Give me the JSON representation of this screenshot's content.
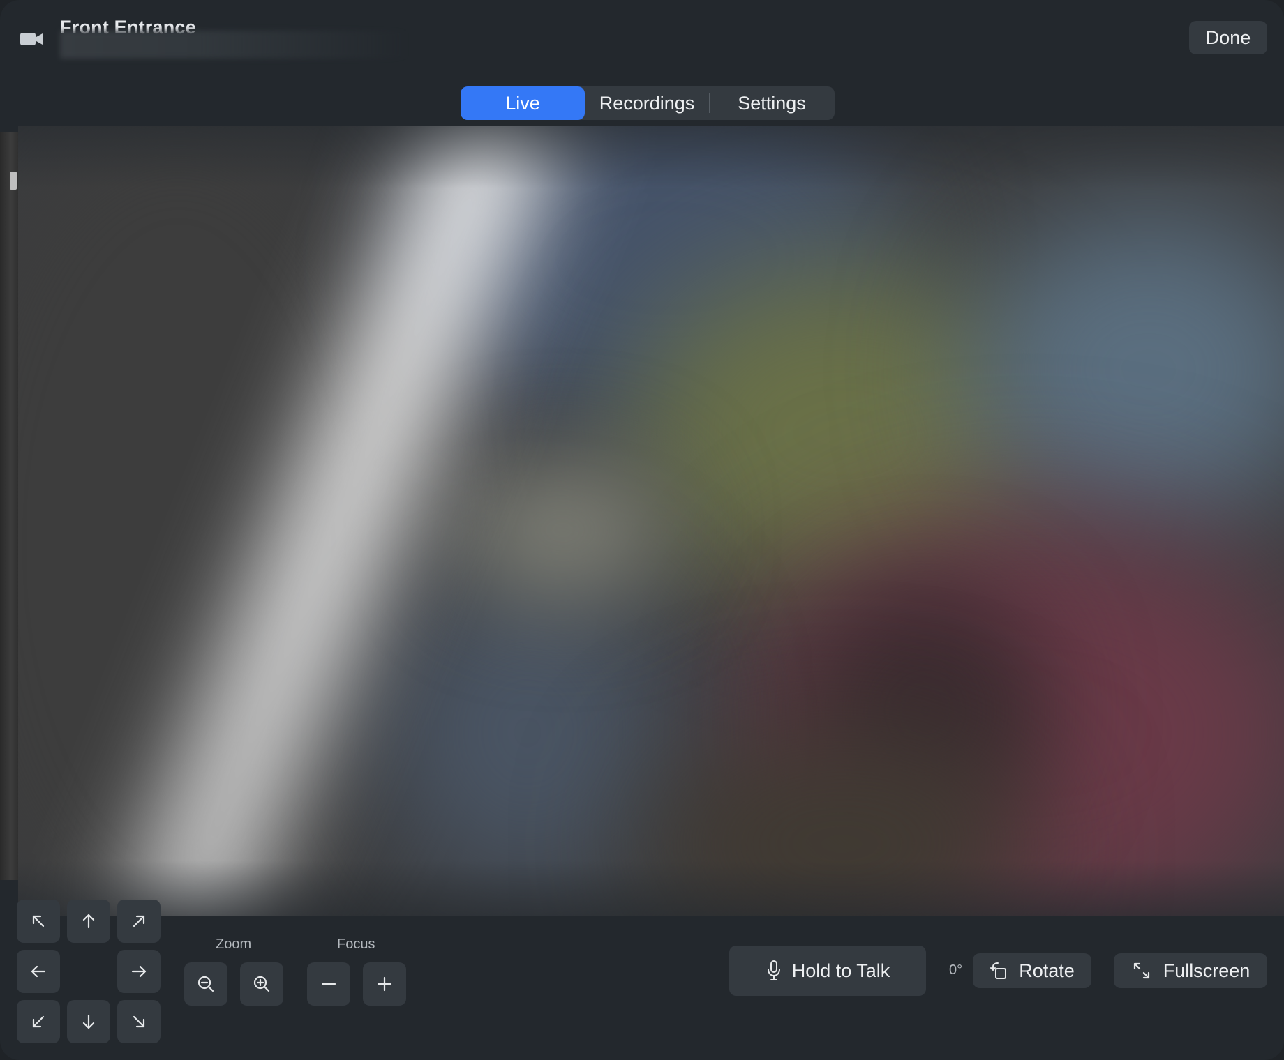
{
  "window": {
    "title": "Front Entrance",
    "done_label": "Done"
  },
  "tabs": [
    {
      "label": "Live",
      "active": true
    },
    {
      "label": "Recordings",
      "active": false
    },
    {
      "label": "Settings",
      "active": false
    }
  ],
  "controls": {
    "zoom_label": "Zoom",
    "focus_label": "Focus",
    "talk_label": "Hold to Talk",
    "rotation_value": "0°",
    "rotate_label": "Rotate",
    "fullscreen_label": "Fullscreen"
  },
  "icons": {
    "camera": "video-camera-icon",
    "pan": [
      "arrow-up-left-icon",
      "arrow-up-icon",
      "arrow-up-right-icon",
      "arrow-left-icon",
      "arrow-right-icon",
      "arrow-down-left-icon",
      "arrow-down-icon",
      "arrow-down-right-icon"
    ],
    "zoom_out": "magnifier-minus-icon",
    "zoom_in": "magnifier-plus-icon",
    "focus_minus": "minus-icon",
    "focus_plus": "plus-icon",
    "mic": "microphone-icon",
    "rotate": "rotate-icon",
    "fullscreen": "expand-arrows-icon"
  },
  "colors": {
    "accent": "#3478f6",
    "background": "#23282d",
    "button": "#343a40",
    "text": "#eef0f2",
    "muted_text": "#b4b9be"
  }
}
